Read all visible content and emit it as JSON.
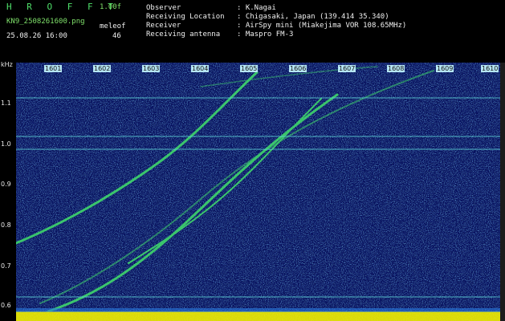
{
  "header": {
    "brand": "H R O F F T",
    "version": "1.00f",
    "filename": "KN9_2508261600.png",
    "datetime": "25.08.26 16:00",
    "meleof_label": "meleof",
    "meleof_value": "46",
    "fields": [
      {
        "label": "Observer",
        "value": ": K.Nagai"
      },
      {
        "label": "Receiving Location",
        "value": ": Chigasaki, Japan (139.414 35.340)"
      },
      {
        "label": "Receiver",
        "value": ": AirSpy mini (Miakejima VOR 108.65MHz)"
      },
      {
        "label": "Receiving antenna",
        "value": ": Maspro FM-3"
      }
    ]
  },
  "spectrogram": {
    "y_unit": "kHz",
    "y_ticks": [
      "1.1",
      "1.0",
      "0.9",
      "0.8",
      "0.7",
      "0.6"
    ],
    "x_ticks": [
      "1601",
      "1602",
      "1603",
      "1604",
      "1605",
      "1606",
      "1607",
      "1608",
      "1609",
      "1610"
    ],
    "colors": {
      "background": "#07105e",
      "noise": "#2a7adf",
      "signal": "#3fe06a",
      "baseline": "#f2f000"
    }
  }
}
